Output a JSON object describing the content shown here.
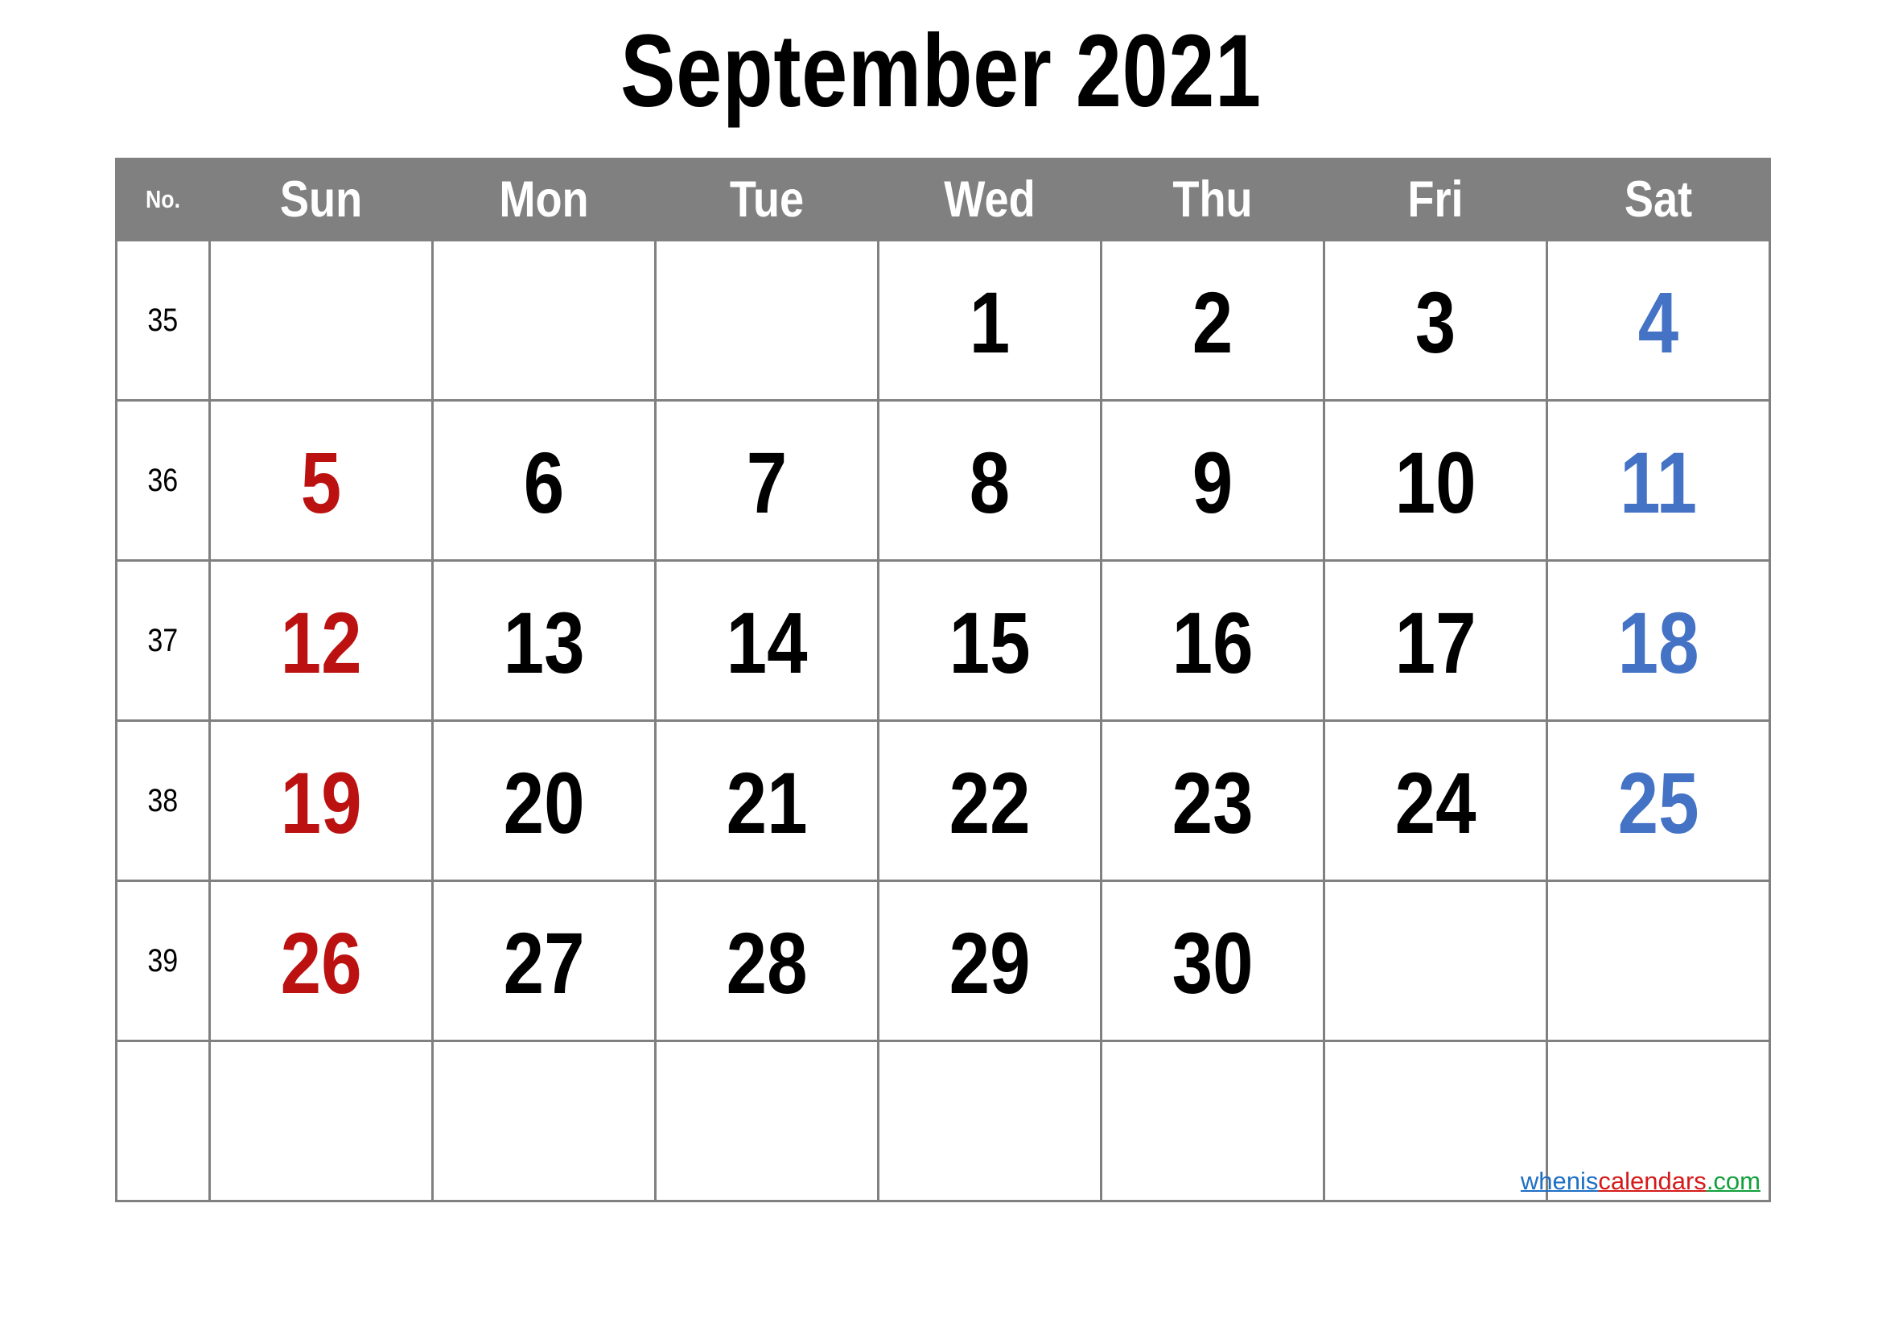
{
  "title": "September 2021",
  "header": {
    "week_number_label": "No.",
    "days": [
      "Sun",
      "Mon",
      "Tue",
      "Wed",
      "Thu",
      "Fri",
      "Sat"
    ]
  },
  "colors": {
    "header_background": "#808080",
    "header_text": "#ffffff",
    "grid_line": "#808080",
    "weekend_cell_background": "#efefef",
    "sunday_date": "#bb1111",
    "saturday_date": "#4472c4",
    "weekday_date": "#000000",
    "page_background": "#ffffff"
  },
  "weeks": [
    {
      "number": "35",
      "days": [
        {
          "date": "",
          "kind": "sun"
        },
        {
          "date": "",
          "kind": "weekday"
        },
        {
          "date": "",
          "kind": "weekday"
        },
        {
          "date": "1",
          "kind": "weekday"
        },
        {
          "date": "2",
          "kind": "weekday"
        },
        {
          "date": "3",
          "kind": "weekday"
        },
        {
          "date": "4",
          "kind": "sat"
        }
      ]
    },
    {
      "number": "36",
      "days": [
        {
          "date": "5",
          "kind": "sun"
        },
        {
          "date": "6",
          "kind": "weekday"
        },
        {
          "date": "7",
          "kind": "weekday"
        },
        {
          "date": "8",
          "kind": "weekday"
        },
        {
          "date": "9",
          "kind": "weekday"
        },
        {
          "date": "10",
          "kind": "weekday"
        },
        {
          "date": "11",
          "kind": "sat"
        }
      ]
    },
    {
      "number": "37",
      "days": [
        {
          "date": "12",
          "kind": "sun"
        },
        {
          "date": "13",
          "kind": "weekday"
        },
        {
          "date": "14",
          "kind": "weekday"
        },
        {
          "date": "15",
          "kind": "weekday"
        },
        {
          "date": "16",
          "kind": "weekday"
        },
        {
          "date": "17",
          "kind": "weekday"
        },
        {
          "date": "18",
          "kind": "sat"
        }
      ]
    },
    {
      "number": "38",
      "days": [
        {
          "date": "19",
          "kind": "sun"
        },
        {
          "date": "20",
          "kind": "weekday"
        },
        {
          "date": "21",
          "kind": "weekday"
        },
        {
          "date": "22",
          "kind": "weekday"
        },
        {
          "date": "23",
          "kind": "weekday"
        },
        {
          "date": "24",
          "kind": "weekday"
        },
        {
          "date": "25",
          "kind": "sat"
        }
      ]
    },
    {
      "number": "39",
      "days": [
        {
          "date": "26",
          "kind": "sun"
        },
        {
          "date": "27",
          "kind": "weekday"
        },
        {
          "date": "28",
          "kind": "weekday"
        },
        {
          "date": "29",
          "kind": "weekday"
        },
        {
          "date": "30",
          "kind": "weekday"
        },
        {
          "date": "",
          "kind": "weekday"
        },
        {
          "date": "",
          "kind": "sat"
        }
      ]
    },
    {
      "number": "",
      "days": [
        {
          "date": "",
          "kind": "sun"
        },
        {
          "date": "",
          "kind": "weekday"
        },
        {
          "date": "",
          "kind": "weekday"
        },
        {
          "date": "",
          "kind": "weekday"
        },
        {
          "date": "",
          "kind": "weekday"
        },
        {
          "date": "",
          "kind": "weekday"
        },
        {
          "date": "",
          "kind": "sat"
        }
      ]
    }
  ],
  "watermark": {
    "part1": "whenis",
    "part2": "calendars",
    "part3": ".com"
  }
}
